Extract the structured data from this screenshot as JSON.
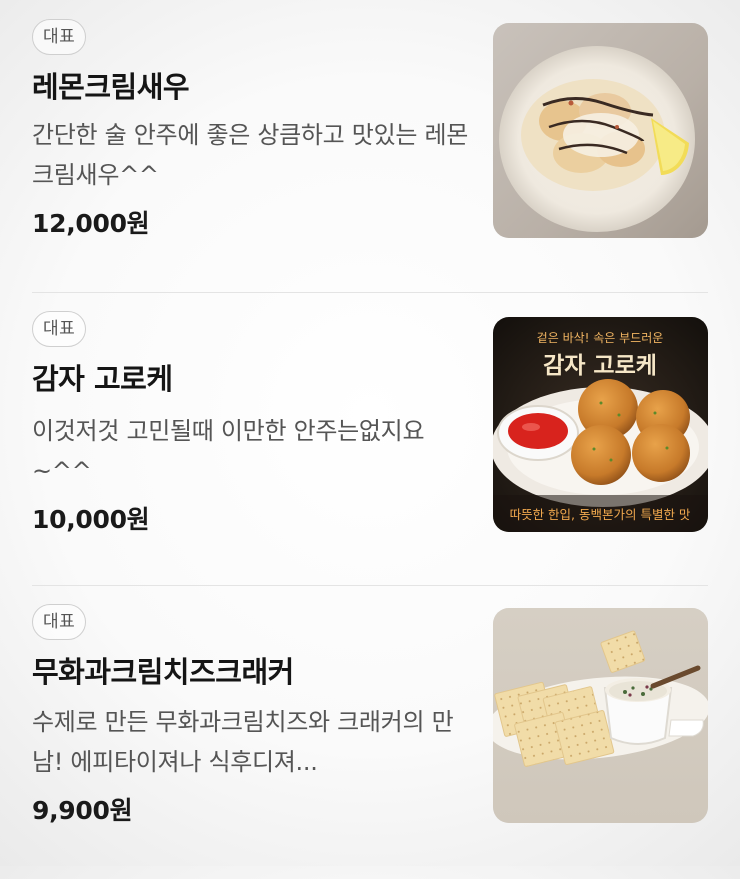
{
  "items": [
    {
      "badge": "대표",
      "name": "레몬크림새우",
      "description": "간단한 술 안주에 좋은 상큼하고 맛있는 레몬크림새우^^",
      "price": "12,000원"
    },
    {
      "badge": "대표",
      "name": "감자 고로케",
      "description": "이것저것 고민될때 이만한 안주는없지요~^^",
      "price": "10,000원",
      "image_text": {
        "top": "겉은 바삭! 속은 부드러운",
        "title": "감자 고로케",
        "bottom": "따뜻한 한입, 동백본가의 특별한 맛"
      }
    },
    {
      "badge": "대표",
      "name": "무화과크림치즈크래커",
      "description": "수제로 만든 무화과크림치즈와 크래커의 만남! 에피타이져나 식후디져...",
      "price": "9,900원"
    }
  ]
}
